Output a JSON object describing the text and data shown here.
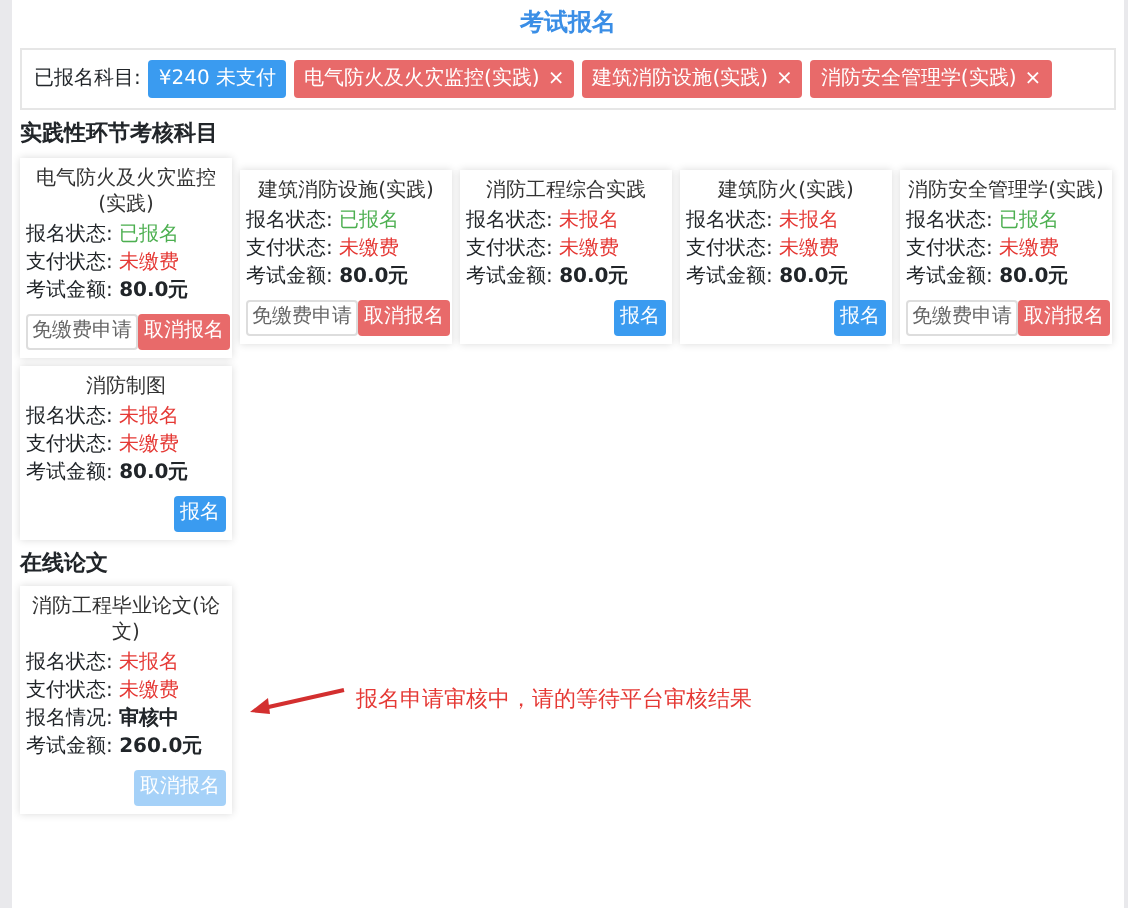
{
  "page_title": "考试报名",
  "registered": {
    "label": "已报名科目:",
    "tags": [
      {
        "text": "¥240 未支付",
        "kind": "payment"
      },
      {
        "text": "电气防火及火灾监控(实践)",
        "kind": "subject",
        "close": "×"
      },
      {
        "text": "建筑消防设施(实践)",
        "kind": "subject",
        "close": "×"
      },
      {
        "text": "消防安全管理学(实践)",
        "kind": "subject",
        "close": "×"
      }
    ]
  },
  "sections": [
    {
      "title": "实践性环节考核科目",
      "cards": [
        {
          "title": "电气防火及火灾监控(实践)",
          "fields": [
            {
              "label": "报名状态:",
              "value": "已报名",
              "color": "#4caf50"
            },
            {
              "label": "支付状态:",
              "value": "未缴费",
              "color": "#e53935"
            },
            {
              "label": "考试金额:",
              "value": "80.0元"
            }
          ],
          "buttons": [
            {
              "label": "免缴费申请",
              "kind": "outline",
              "disabled": false
            },
            {
              "label": "取消报名",
              "kind": "danger",
              "disabled": false
            }
          ]
        },
        {
          "title": "建筑消防设施(实践)",
          "fields": [
            {
              "label": "报名状态:",
              "value": "已报名",
              "color": "#4caf50"
            },
            {
              "label": "支付状态:",
              "value": "未缴费",
              "color": "#e53935"
            },
            {
              "label": "考试金额:",
              "value": "80.0元"
            }
          ],
          "buttons": [
            {
              "label": "免缴费申请",
              "kind": "outline",
              "disabled": false
            },
            {
              "label": "取消报名",
              "kind": "danger",
              "disabled": false
            }
          ]
        },
        {
          "title": "消防工程综合实践",
          "fields": [
            {
              "label": "报名状态:",
              "value": "未报名",
              "color": "#e53935"
            },
            {
              "label": "支付状态:",
              "value": "未缴费",
              "color": "#e53935"
            },
            {
              "label": "考试金额:",
              "value": "80.0元"
            }
          ],
          "buttons": [
            {
              "label": "报名",
              "kind": "primary",
              "disabled": false
            }
          ]
        },
        {
          "title": "建筑防火(实践)",
          "fields": [
            {
              "label": "报名状态:",
              "value": "未报名",
              "color": "#e53935"
            },
            {
              "label": "支付状态:",
              "value": "未缴费",
              "color": "#e53935"
            },
            {
              "label": "考试金额:",
              "value": "80.0元"
            }
          ],
          "buttons": [
            {
              "label": "报名",
              "kind": "primary",
              "disabled": false
            }
          ]
        },
        {
          "title": "消防安全管理学(实践)",
          "fields": [
            {
              "label": "报名状态:",
              "value": "已报名",
              "color": "#4caf50"
            },
            {
              "label": "支付状态:",
              "value": "未缴费",
              "color": "#e53935"
            },
            {
              "label": "考试金额:",
              "value": "80.0元"
            }
          ],
          "buttons": [
            {
              "label": "免缴费申请",
              "kind": "outline",
              "disabled": false
            },
            {
              "label": "取消报名",
              "kind": "danger",
              "disabled": false
            }
          ]
        },
        {
          "title": "消防制图",
          "fields": [
            {
              "label": "报名状态:",
              "value": "未报名",
              "color": "#e53935"
            },
            {
              "label": "支付状态:",
              "value": "未缴费",
              "color": "#e53935"
            },
            {
              "label": "考试金额:",
              "value": "80.0元"
            }
          ],
          "buttons": [
            {
              "label": "报名",
              "kind": "primary",
              "disabled": false
            }
          ]
        }
      ]
    },
    {
      "title": "在线论文",
      "cards": [
        {
          "title": "消防工程毕业论文(论文)",
          "fields": [
            {
              "label": "报名状态:",
              "value": "未报名",
              "color": "#e53935"
            },
            {
              "label": "支付状态:",
              "value": "未缴费",
              "color": "#e53935"
            },
            {
              "label": "报名情况:",
              "value": "审核中"
            },
            {
              "label": "考试金额:",
              "value": "260.0元"
            }
          ],
          "buttons": [
            {
              "label": "取消报名",
              "kind": "primary",
              "disabled": true
            }
          ]
        }
      ],
      "annotation": "报名申请审核中，请的等待平台审核结果"
    }
  ]
}
